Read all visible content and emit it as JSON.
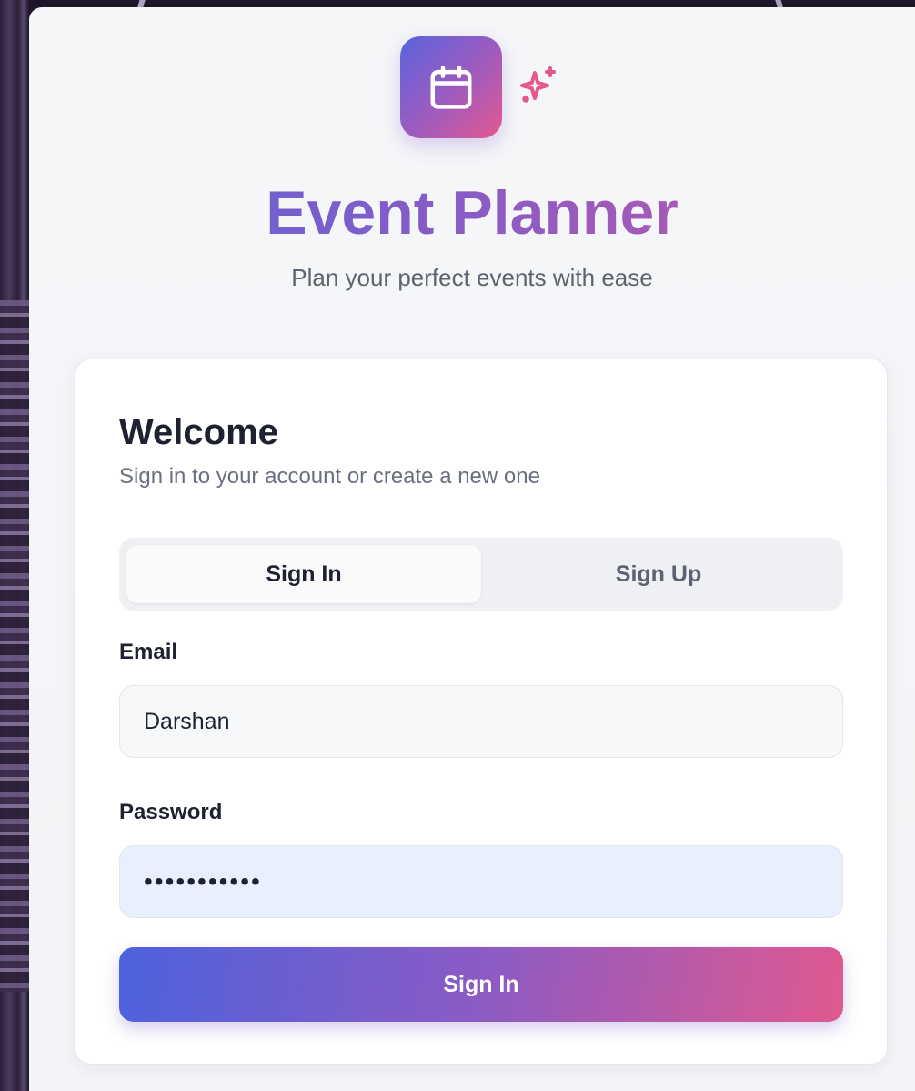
{
  "app": {
    "title": "Event Planner",
    "subtitle": "Plan your perfect events with ease",
    "logo_icon": "calendar-icon",
    "accent_icon": "sparkles-icon"
  },
  "card": {
    "title": "Welcome",
    "subtitle": "Sign in to your account or create a new one"
  },
  "tabs": [
    {
      "label": "Sign In",
      "active": true
    },
    {
      "label": "Sign Up",
      "active": false
    }
  ],
  "form": {
    "email_label": "Email",
    "email_value": "Darshan",
    "password_label": "Password",
    "password_value": "•••••••••••",
    "submit_label": "Sign In"
  },
  "colors": {
    "gradient_start": "#4d62dc",
    "gradient_mid": "#8b5bc4",
    "gradient_end": "#e0598f",
    "sparkle": "#e5588f"
  }
}
